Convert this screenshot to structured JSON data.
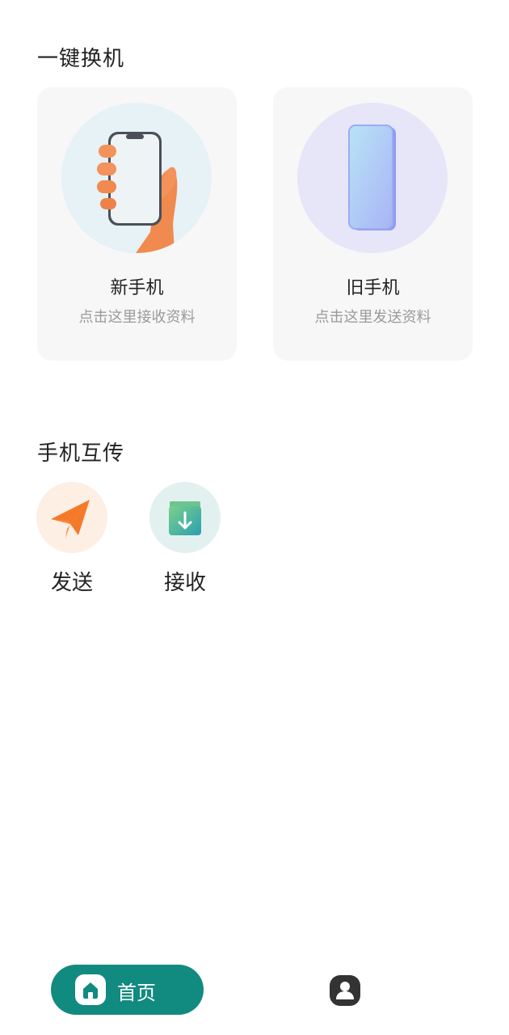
{
  "sections": {
    "switch_title": "一键换机",
    "transfer_title": "手机互传"
  },
  "cards": [
    {
      "title": "新手机",
      "subtitle": "点击这里接收资料",
      "icon": "hand-holding-phone-icon",
      "circle_color": "#e6f2f5"
    },
    {
      "title": "旧手机",
      "subtitle": "点击这里发送资料",
      "icon": "old-phone-icon",
      "circle_color": "#e7e6f8"
    }
  ],
  "transfer": [
    {
      "label": "发送",
      "icon": "paper-plane-icon",
      "circle_color": "#fdefe4",
      "icon_color": "#f47a2a"
    },
    {
      "label": "接收",
      "icon": "download-box-icon",
      "circle_color": "#e2f1f0",
      "icon_color": "#2aa89b"
    }
  ],
  "tabbar": {
    "home_label": "首页",
    "home_icon": "home-icon",
    "profile_icon": "user-profile-icon",
    "accent": "#118a80"
  }
}
